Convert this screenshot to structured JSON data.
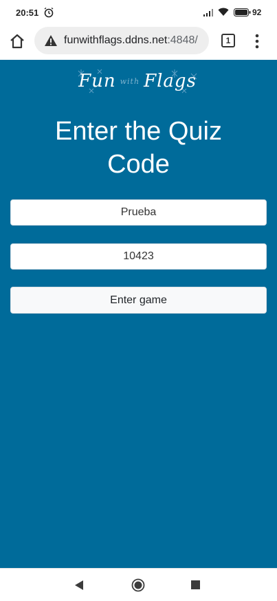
{
  "status_bar": {
    "time": "20:51",
    "battery": "92"
  },
  "browser": {
    "url_main": "funwithflags.ddns.net",
    "url_port": ":4848/",
    "tab_count": "1"
  },
  "page": {
    "logo": {
      "fun": "Fun",
      "with": "with",
      "flags": "Flags"
    },
    "heading_line1": "Enter the Quiz",
    "heading_line2": "Code",
    "name_field_value": "Prueba",
    "code_field_value": "10423",
    "enter_button_label": "Enter game"
  },
  "colors": {
    "page_background": "#006b9a",
    "heading": "#ffffff"
  }
}
